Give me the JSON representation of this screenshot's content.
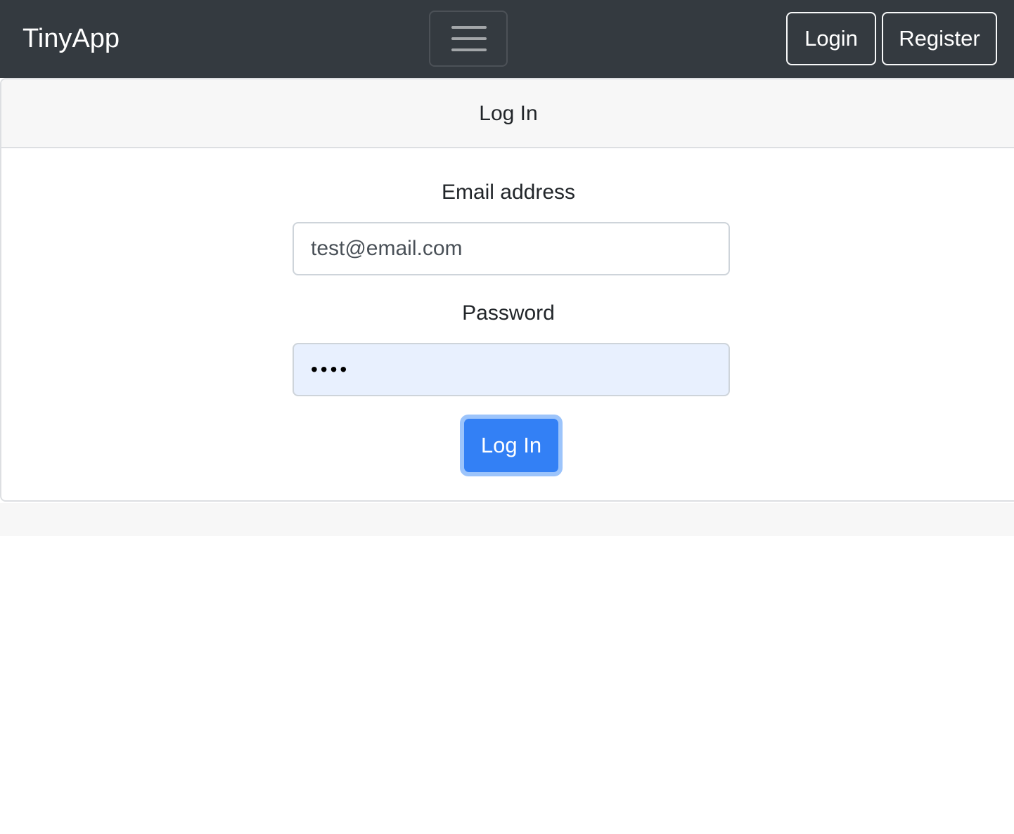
{
  "navbar": {
    "brand": "TinyApp",
    "toggler_icon": "hamburger-menu-icon",
    "login_label": "Login",
    "register_label": "Register"
  },
  "card": {
    "title": "Log In",
    "email_label": "Email address",
    "email_value": "test@email.com",
    "password_label": "Password",
    "password_value": "••••",
    "submit_label": "Log In"
  },
  "colors": {
    "navbar_bg": "#343a40",
    "primary": "#3380f5",
    "autofill_bg": "#e8f0fe"
  }
}
